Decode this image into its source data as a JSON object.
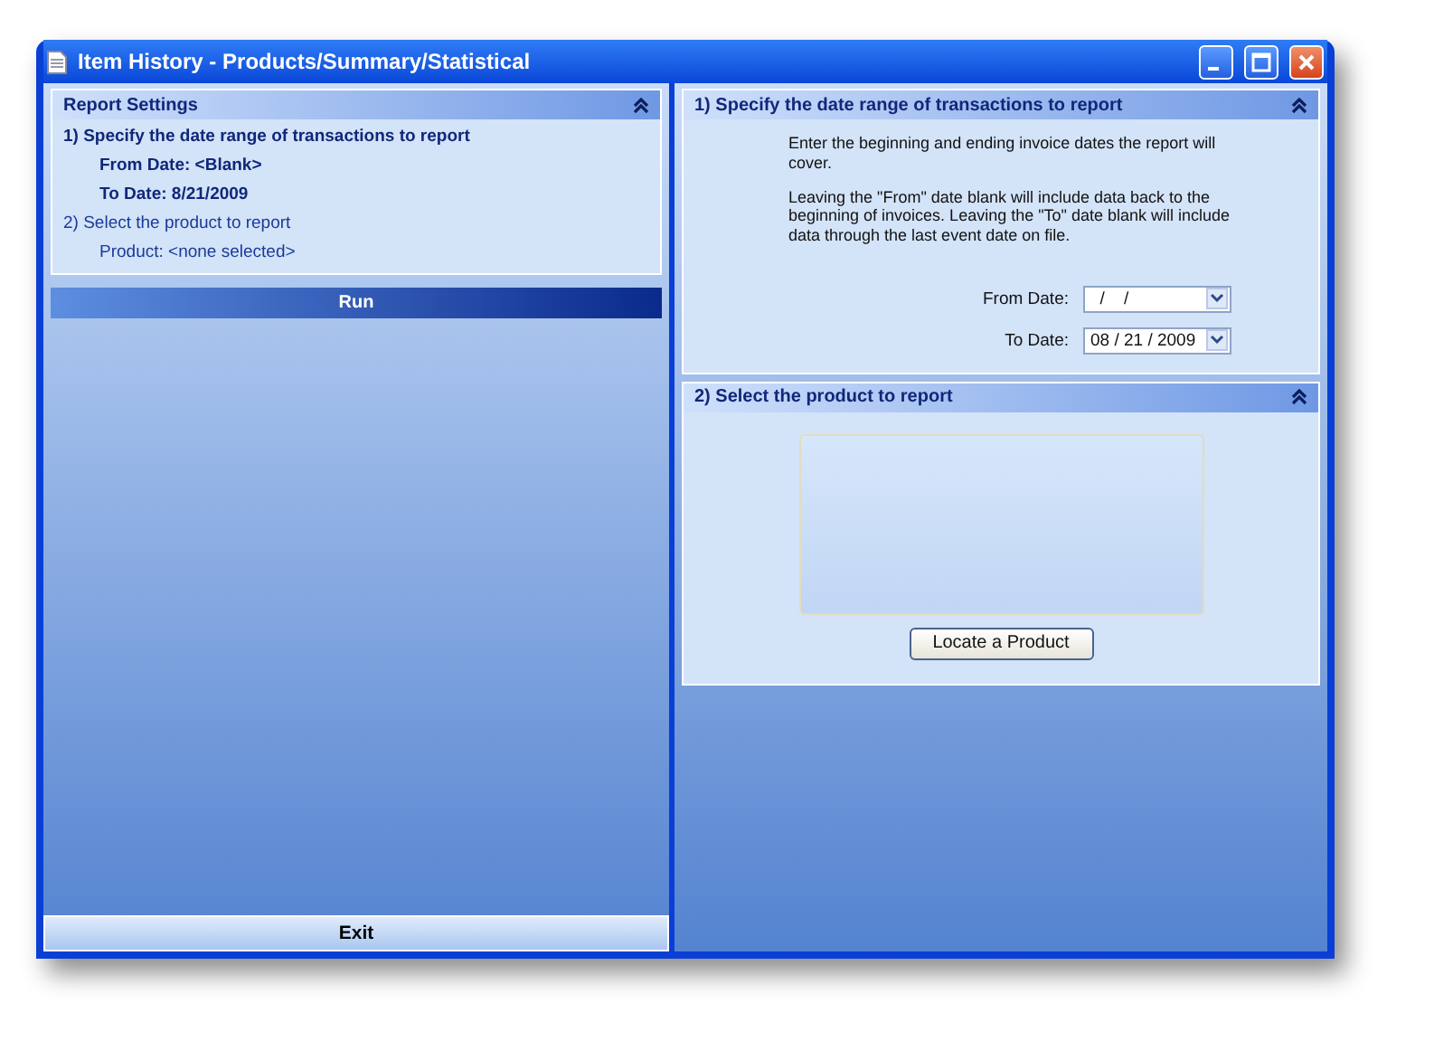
{
  "window": {
    "title": "Item History - Products/Summary/Statistical"
  },
  "report_settings": {
    "title": "Report Settings",
    "steps": [
      {
        "label": "1)  Specify the date range of transactions to report",
        "selected": true,
        "lines": [
          "From Date:  <Blank>",
          "To Date:  8/21/2009"
        ]
      },
      {
        "label": "2)  Select the product to report",
        "selected": false,
        "lines": [
          "Product:  <none selected>"
        ]
      }
    ]
  },
  "run_button": "Run",
  "exit_button": "Exit",
  "date_section": {
    "title": "1)  Specify the date range of transactions to report",
    "paragraphs": [
      "Enter the beginning and ending invoice dates the report will cover.",
      "Leaving the \"From\" date blank will include data back to the beginning of invoices. Leaving the \"To\" date blank will include data through the last event date on file."
    ],
    "fields": [
      {
        "label": "From Date:",
        "value": "  /    /"
      },
      {
        "label": "To Date:",
        "value": "08 / 21 / 2009"
      }
    ]
  },
  "product_section": {
    "title": "2)  Select the product to report",
    "button": "Locate a Product"
  }
}
